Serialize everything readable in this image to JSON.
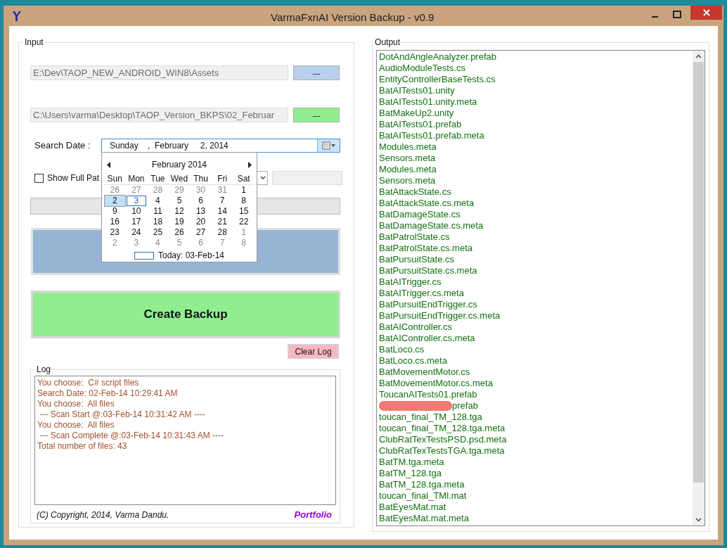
{
  "window": {
    "title": "VarmaFxnAI Version Backup - v0.9"
  },
  "input": {
    "label": "Input",
    "source_path": "E:\\Dev\\TAOP_NEW_ANDROID_WIN8\\Assets",
    "source_browse": "---",
    "backup_path": "C:\\Users\\varma\\Desktop\\TAOP_Version_BKPS\\02_Februar",
    "backup_browse": "---",
    "search_date_label": "Search Date :",
    "search_date": "Sunday    ,  February     2, 2014",
    "show_full_path": {
      "label": "Show Full Pat",
      "checked": false
    },
    "progress": {
      "level": 0
    },
    "create_backup": "Create Backup",
    "clear_log": "Clear Log"
  },
  "calendar": {
    "month": "February 2014",
    "weekdays": [
      "Sun",
      "Mon",
      "Tue",
      "Wed",
      "Thu",
      "Fri",
      "Sat"
    ],
    "today": "Today: 03-Feb-14",
    "weeks": [
      [
        {
          "label": "26",
          "other_month": true,
          "selected": false,
          "today": false
        },
        {
          "label": "27",
          "other_month": true,
          "selected": false,
          "today": false
        },
        {
          "label": "28",
          "other_month": true,
          "selected": false,
          "today": false
        },
        {
          "label": "29",
          "other_month": true,
          "selected": false,
          "today": false
        },
        {
          "label": "30",
          "other_month": true,
          "selected": false,
          "today": false
        },
        {
          "label": "31",
          "other_month": true,
          "selected": false,
          "today": false
        },
        {
          "label": "1",
          "other_month": false,
          "selected": false,
          "today": false
        }
      ],
      [
        {
          "label": "2",
          "other_month": false,
          "selected": true,
          "today": false
        },
        {
          "label": "3",
          "other_month": false,
          "selected": false,
          "today": true
        },
        {
          "label": "4",
          "other_month": false,
          "selected": false,
          "today": false
        },
        {
          "label": "5",
          "other_month": false,
          "selected": false,
          "today": false
        },
        {
          "label": "6",
          "other_month": false,
          "selected": false,
          "today": false
        },
        {
          "label": "7",
          "other_month": false,
          "selected": false,
          "today": false
        },
        {
          "label": "8",
          "other_month": false,
          "selected": false,
          "today": false
        }
      ],
      [
        {
          "label": "9",
          "other_month": false,
          "selected": false,
          "today": false
        },
        {
          "label": "10",
          "other_month": false,
          "selected": false,
          "today": false
        },
        {
          "label": "11",
          "other_month": false,
          "selected": false,
          "today": false
        },
        {
          "label": "12",
          "other_month": false,
          "selected": false,
          "today": false
        },
        {
          "label": "13",
          "other_month": false,
          "selected": false,
          "today": false
        },
        {
          "label": "14",
          "other_month": false,
          "selected": false,
          "today": false
        },
        {
          "label": "15",
          "other_month": false,
          "selected": false,
          "today": false
        }
      ],
      [
        {
          "label": "16",
          "other_month": false,
          "selected": false,
          "today": false
        },
        {
          "label": "17",
          "other_month": false,
          "selected": false,
          "today": false
        },
        {
          "label": "18",
          "other_month": false,
          "selected": false,
          "today": false
        },
        {
          "label": "19",
          "other_month": false,
          "selected": false,
          "today": false
        },
        {
          "label": "20",
          "other_month": false,
          "selected": false,
          "today": false
        },
        {
          "label": "21",
          "other_month": false,
          "selected": false,
          "today": false
        },
        {
          "label": "22",
          "other_month": false,
          "selected": false,
          "today": false
        }
      ],
      [
        {
          "label": "23",
          "other_month": false,
          "selected": false,
          "today": false
        },
        {
          "label": "24",
          "other_month": false,
          "selected": false,
          "today": false
        },
        {
          "label": "25",
          "other_month": false,
          "selected": false,
          "today": false
        },
        {
          "label": "26",
          "other_month": false,
          "selected": false,
          "today": false
        },
        {
          "label": "27",
          "other_month": false,
          "selected": false,
          "today": false
        },
        {
          "label": "28",
          "other_month": false,
          "selected": false,
          "today": false
        },
        {
          "label": "1",
          "other_month": true,
          "selected": false,
          "today": false
        }
      ],
      [
        {
          "label": "2",
          "other_month": true,
          "selected": false,
          "today": false
        },
        {
          "label": "3",
          "other_month": true,
          "selected": false,
          "today": false
        },
        {
          "label": "4",
          "other_month": true,
          "selected": false,
          "today": false
        },
        {
          "label": "5",
          "other_month": true,
          "selected": false,
          "today": false
        },
        {
          "label": "6",
          "other_month": true,
          "selected": false,
          "today": false
        },
        {
          "label": "7",
          "other_month": true,
          "selected": false,
          "today": false
        },
        {
          "label": "8",
          "other_month": true,
          "selected": false,
          "today": false
        }
      ]
    ]
  },
  "log": {
    "label": "Log",
    "lines": [
      "You choose:  C# script files",
      "Search Date: 02-Feb-14 10:29:41 AM",
      "You choose:  All files",
      " --- Scan Start @:03-Feb-14 10:31:42 AM ----",
      "You choose:  All files",
      " --- Scan Complete @:03-Feb-14 10:31:43 AM ----",
      "Total number of files: 43"
    ],
    "copyright": "(C) Copyright, 2014, Varma Dandu.",
    "portfolio_link": "Portfolio"
  },
  "output": {
    "label": "Output",
    "files": [
      {
        "name": "DotAndAngleAnalyzer.prefab",
        "redacted": false
      },
      {
        "name": "AudioModuleTests.cs",
        "redacted": false
      },
      {
        "name": "EntityControllerBaseTests.cs",
        "redacted": false
      },
      {
        "name": "BatAITests01.unity",
        "redacted": false
      },
      {
        "name": "BatAITests01.unity.meta",
        "redacted": false
      },
      {
        "name": "BatMakeUp2.unity",
        "redacted": false
      },
      {
        "name": "BatAITests01.prefab",
        "redacted": false
      },
      {
        "name": "BatAITests01.prefab.meta",
        "redacted": false
      },
      {
        "name": "Modules.meta",
        "redacted": false
      },
      {
        "name": "Sensors.meta",
        "redacted": false
      },
      {
        "name": "Modules.meta",
        "redacted": false
      },
      {
        "name": "Sensors.meta",
        "redacted": false
      },
      {
        "name": "BatAttackState.cs",
        "redacted": false
      },
      {
        "name": "BatAttackState.cs.meta",
        "redacted": false
      },
      {
        "name": "BatDamageState.cs",
        "redacted": false
      },
      {
        "name": "BatDamageState.cs.meta",
        "redacted": false
      },
      {
        "name": "BatPatrolState.cs",
        "redacted": false
      },
      {
        "name": "BatPatrolState.cs.meta",
        "redacted": false
      },
      {
        "name": "BatPursuitState.cs",
        "redacted": false
      },
      {
        "name": "BatPursuitState.cs.meta",
        "redacted": false
      },
      {
        "name": "BatAITrigger.cs",
        "redacted": false
      },
      {
        "name": "BatAITrigger.cs.meta",
        "redacted": false
      },
      {
        "name": "BatPursuitEndTrigger.cs",
        "redacted": false
      },
      {
        "name": "BatPursuitEndTrigger.cs.meta",
        "redacted": false
      },
      {
        "name": "BatAIController.cs",
        "redacted": false
      },
      {
        "name": "BatAIController.cs.meta",
        "redacted": false
      },
      {
        "name": "BatLoco.cs",
        "redacted": false
      },
      {
        "name": "BatLoco.cs.meta",
        "redacted": false
      },
      {
        "name": "BatMovementMotor.cs",
        "redacted": false
      },
      {
        "name": "BatMovementMotor.cs.meta",
        "redacted": false
      },
      {
        "name": "ToucanAITests01.prefab",
        "redacted": false
      },
      {
        "name": "prefab",
        "redacted": true
      },
      {
        "name": "toucan_final_TM_128.tga",
        "redacted": false
      },
      {
        "name": "toucan_final_TM_128.tga.meta",
        "redacted": false
      },
      {
        "name": "ClubRatTexTestsPSD.psd.meta",
        "redacted": false
      },
      {
        "name": "ClubRatTexTestsTGA.tga.meta",
        "redacted": false
      },
      {
        "name": "BatTM.tga.meta",
        "redacted": false
      },
      {
        "name": "BatTM_128.tga",
        "redacted": false
      },
      {
        "name": "BatTM_128.tga.meta",
        "redacted": false
      },
      {
        "name": "toucan_final_TMl.mat",
        "redacted": false
      },
      {
        "name": "BatEyesMat.mat",
        "redacted": false
      },
      {
        "name": "BatEyesMat.mat.meta",
        "redacted": false
      }
    ]
  }
}
